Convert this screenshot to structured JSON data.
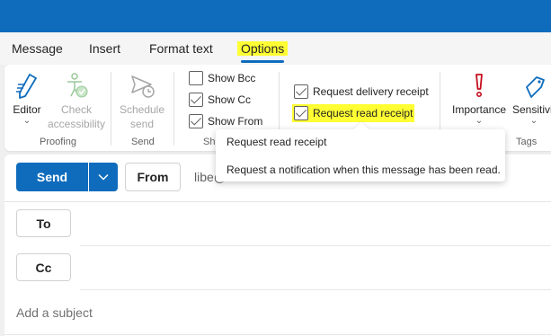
{
  "tabs": [
    "Message",
    "Insert",
    "Format text",
    "Options"
  ],
  "ribbon": {
    "editor": "Editor",
    "check_accessibility_line1": "Check",
    "check_accessibility_line2": "accessibility",
    "schedule_line1": "Schedule",
    "schedule_line2": "send",
    "show_bcc": "Show Bcc",
    "show_cc": "Show Cc",
    "show_from": "Show From",
    "delivery_receipt": "Request delivery receipt",
    "read_receipt": "Request read receipt",
    "importance": "Importance",
    "sensitivity": "Sensitivit",
    "groups": {
      "proofing": "Proofing",
      "send": "Send",
      "show": "Sh",
      "tags": "Tags"
    }
  },
  "tooltip": {
    "title": "Request read receipt",
    "description": "Request a notification when this message has been read."
  },
  "compose": {
    "send_label": "Send",
    "from_label": "From",
    "from_value": "libe@",
    "to_label": "To",
    "cc_label": "Cc",
    "subject_placeholder": "Add a subject"
  },
  "colors": {
    "brand": "#0f6cbd",
    "highlight": "#ffff33",
    "importance": "#c50f1f"
  }
}
